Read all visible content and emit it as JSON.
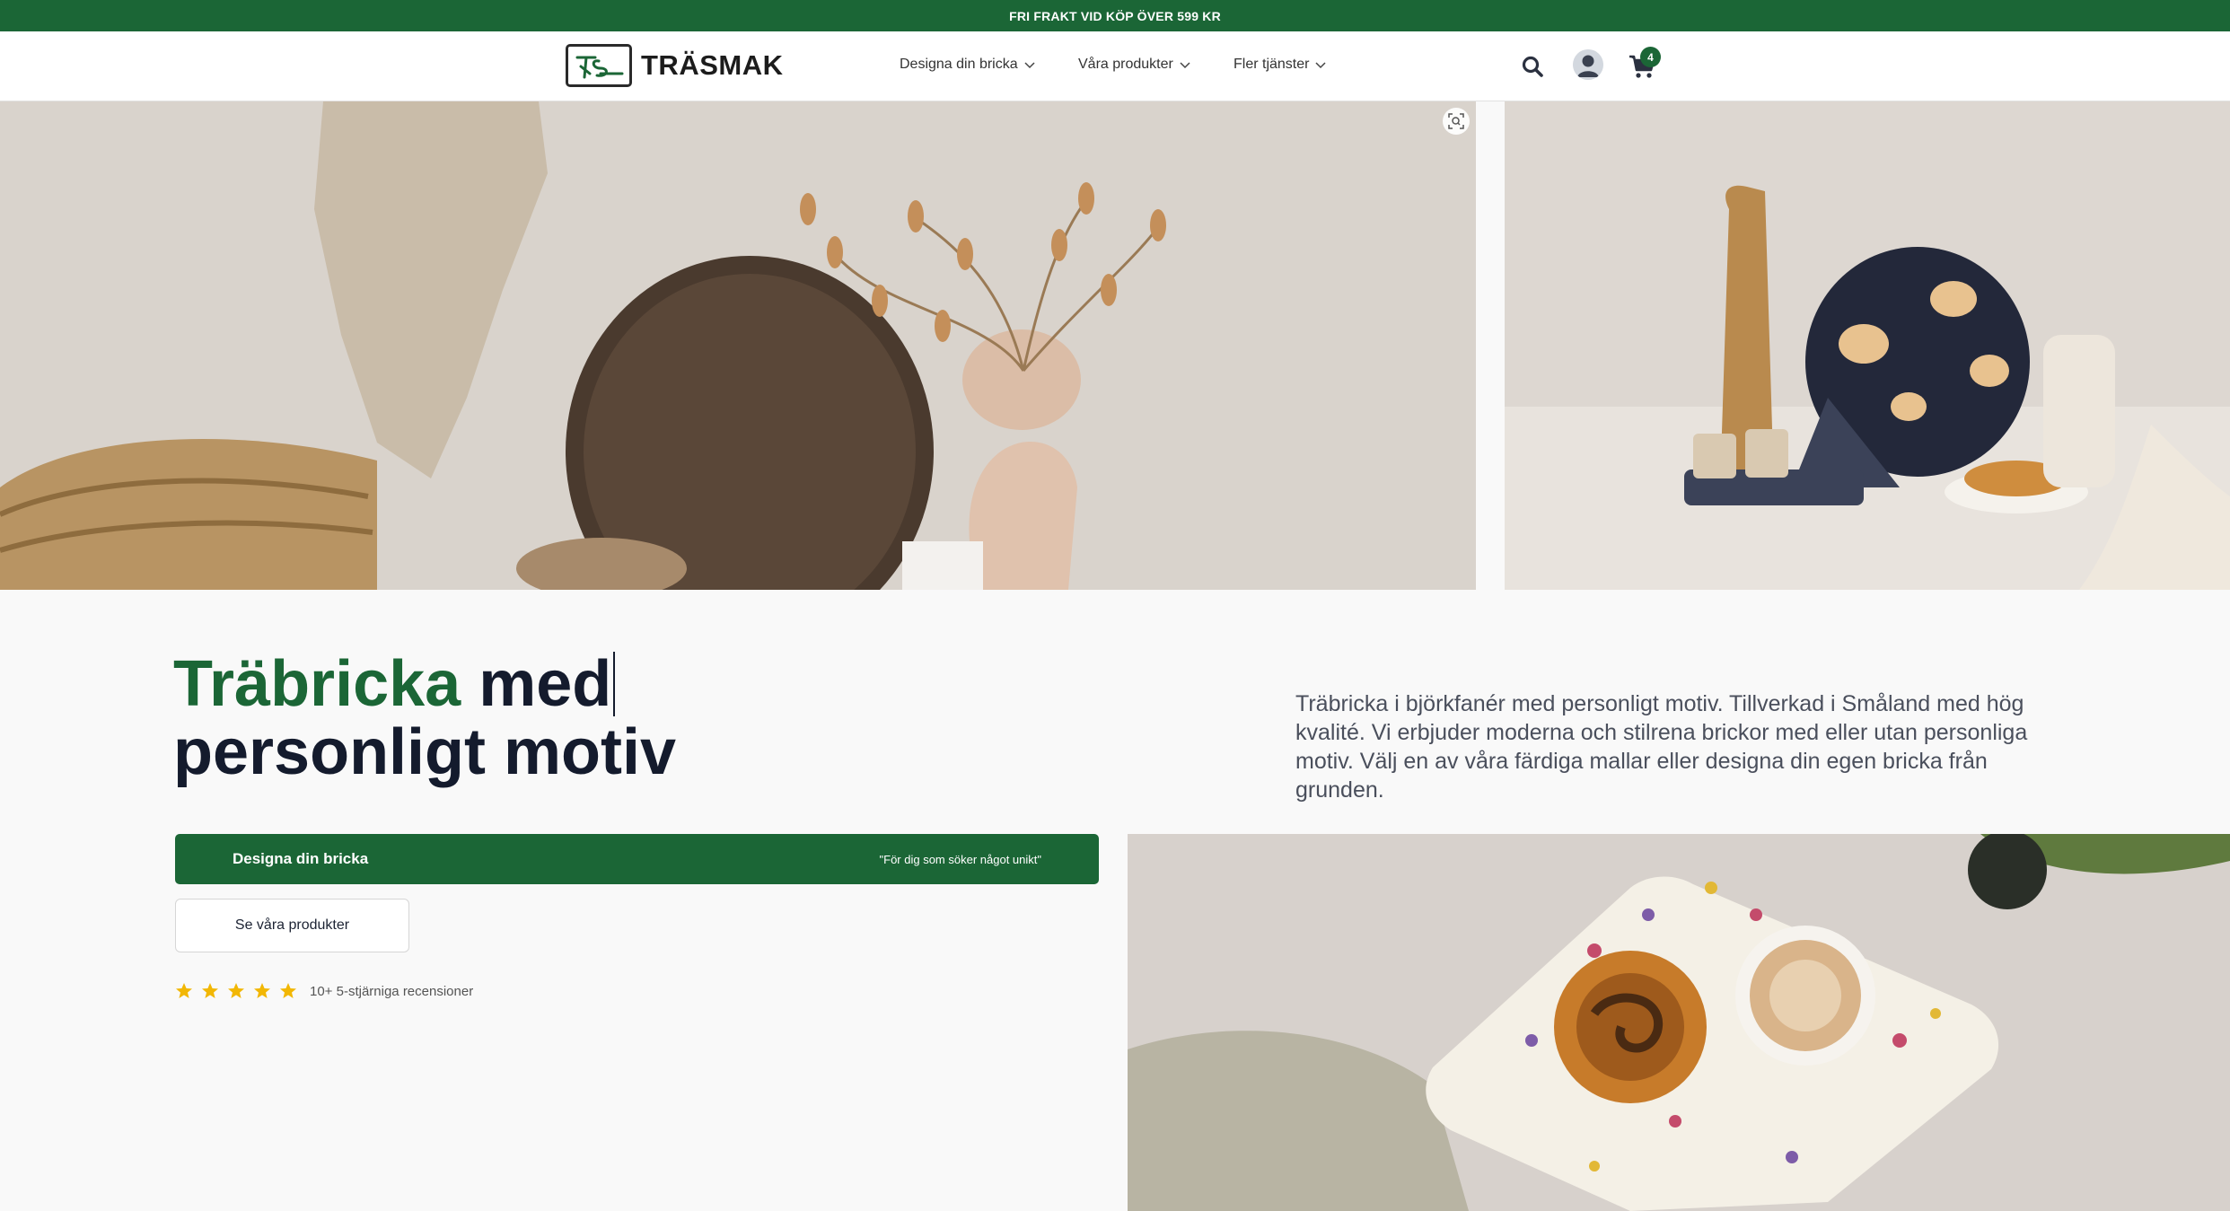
{
  "promo": {
    "text": "FRI FRAKT VID KÖP ÖVER 599 KR"
  },
  "header": {
    "logo_text": "TRÄSMAK",
    "logo_mark_text": "TS",
    "nav": [
      {
        "label": "Designa din bricka"
      },
      {
        "label": "Våra produkter"
      },
      {
        "label": "Fler tjänster"
      }
    ],
    "cart_count": "4"
  },
  "hero": {
    "title_highlight": "Träbricka",
    "title_rest": " med",
    "title_line2": "personligt motiv",
    "description": "Träbricka i björkfanér med personligt motiv. Tillverkad i Småland med hög kvalité. Vi erbjuder moderna och stilrena brickor med eller utan personliga motiv. Välj en av våra färdiga mallar eller designa din egen bricka från grunden.",
    "primary_cta": {
      "label": "Designa din bricka",
      "sub": "\"För dig som söker något unikt\""
    },
    "secondary_cta": {
      "label": "Se våra produkter"
    },
    "rating": {
      "stars": 5,
      "text": "10+ 5-stjärniga recensioner"
    }
  },
  "colors": {
    "brand_green": "#1b6636",
    "star_gold": "#f2b705",
    "heading": "#141b2d"
  },
  "icons": [
    "search-icon",
    "user-avatar-icon",
    "cart-icon",
    "chevron-down-icon",
    "zoom-icon",
    "star-icon"
  ]
}
